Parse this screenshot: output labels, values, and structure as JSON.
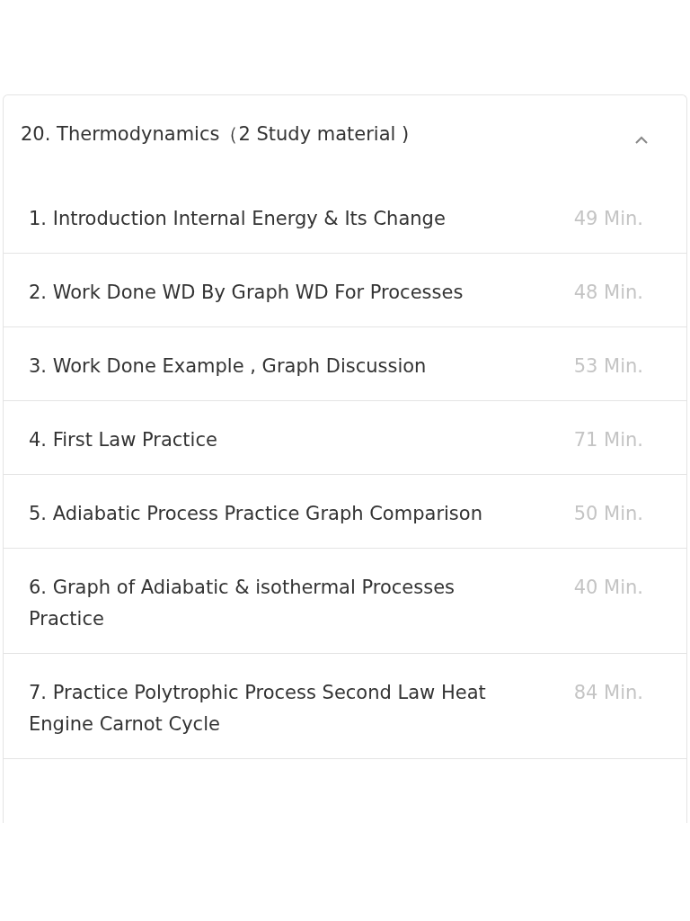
{
  "section": {
    "title": "20. Thermodynamics（2 Study material )",
    "expanded": true,
    "lessons": [
      {
        "title": "1. Introduction Internal Energy & Its Change",
        "duration": "49 Min."
      },
      {
        "title": "2. Work Done WD By Graph WD For Processes",
        "duration": "48 Min."
      },
      {
        "title": "3. Work Done Example , Graph Discussion",
        "duration": "53 Min."
      },
      {
        "title": "4. First Law Practice",
        "duration": "71 Min."
      },
      {
        "title": "5. Adiabatic Process Practice Graph Comparison",
        "duration": "50 Min."
      },
      {
        "title": "6. Graph of Adiabatic & isothermal Processes Practice",
        "duration": "40 Min."
      },
      {
        "title": "7. Practice Polytrophic Process Second Law Heat Engine Carnot Cycle",
        "duration": "84 Min."
      }
    ]
  }
}
